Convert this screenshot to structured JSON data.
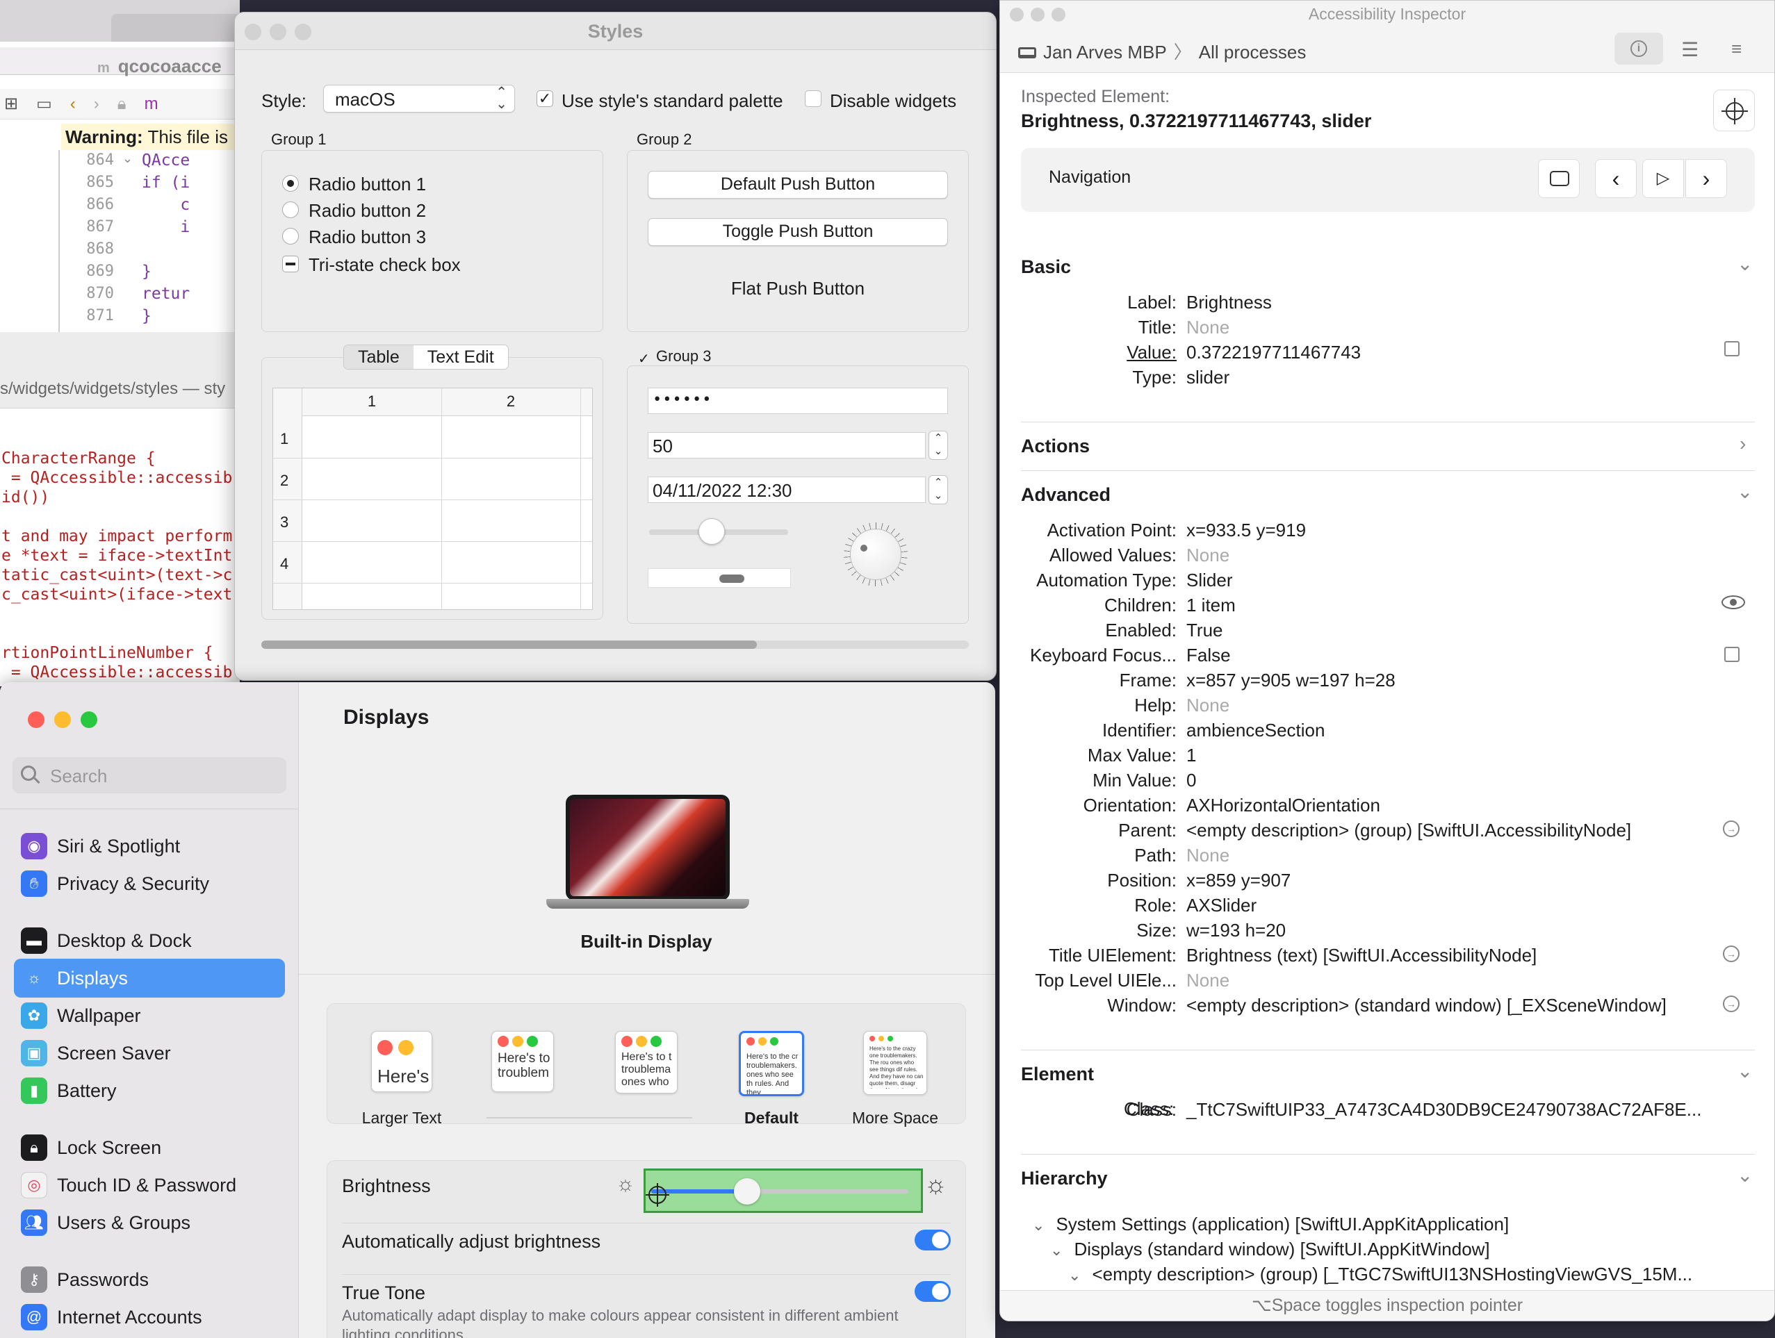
{
  "xcode": {
    "tab": "qcocoaacce",
    "warning_bold": "Warning:",
    "warning_text": " This file is",
    "lines": [
      {
        "n": "864",
        "code": "QAcce"
      },
      {
        "n": "865",
        "code": "if (i"
      },
      {
        "n": "866",
        "code": "    c"
      },
      {
        "n": "867",
        "code": "    i"
      },
      {
        "n": "868",
        "code": ""
      },
      {
        "n": "869",
        "code": "}"
      },
      {
        "n": "870",
        "code": "retur"
      },
      {
        "n": "871",
        "code": "}"
      }
    ]
  },
  "editor2": {
    "path": "s/widgets/widgets/styles — sty",
    "lines": [
      "CharacterRange {",
      " = QAccessible::accessib",
      "id())",
      "",
      "t and may impact perform",
      "e *text = iface->textInt",
      "tatic_cast<uint>(text->c",
      "c_cast<uint>(iface->text",
      "",
      "",
      "rtionPointLineNumber {",
      " = QAccessible::accessib"
    ]
  },
  "styles": {
    "title": "Styles",
    "style_label": "Style:",
    "style_value": "macOS",
    "palette_label": "Use style's standard palette",
    "disable_label": "Disable widgets",
    "group1": {
      "title": "Group 1",
      "radios": [
        "Radio button 1",
        "Radio button 2",
        "Radio button 3"
      ],
      "tristate": "Tri-state check box"
    },
    "group2": {
      "title": "Group 2",
      "default_btn": "Default Push Button",
      "toggle_btn": "Toggle Push Button",
      "flat_btn": "Flat Push Button"
    },
    "tabs": [
      "Table",
      "Text Edit"
    ],
    "table": {
      "cols": [
        "1",
        "2"
      ],
      "rows": [
        "1",
        "2",
        "3",
        "4"
      ]
    },
    "group3": {
      "title": "Group 3",
      "password": "••••••",
      "spin": "50",
      "datetime": "04/11/2022 12:30",
      "slider_value": 0.45,
      "dial_value": 0.35
    },
    "scroll_value": 0.7
  },
  "settings": {
    "search_placeholder": "Search",
    "items": [
      {
        "label": "Siri & Spotlight",
        "icon": "siri-icon",
        "color": "#7a4fd6"
      },
      {
        "label": "Privacy & Security",
        "icon": "hand-icon",
        "color": "#3478f6"
      },
      {
        "label": "Desktop & Dock",
        "icon": "dock-icon",
        "color": "#1c1c1e"
      },
      {
        "label": "Displays",
        "icon": "sun-icon",
        "color": "#3478f6"
      },
      {
        "label": "Wallpaper",
        "icon": "flower-icon",
        "color": "#3aa7e8"
      },
      {
        "label": "Screen Saver",
        "icon": "screensaver-icon",
        "color": "#4fb5e6"
      },
      {
        "label": "Battery",
        "icon": "battery-icon",
        "color": "#34c759"
      },
      {
        "label": "Lock Screen",
        "icon": "lock-icon",
        "color": "#1c1c1e"
      },
      {
        "label": "Touch ID & Password",
        "icon": "fingerprint-icon",
        "color": "#f2f2f2"
      },
      {
        "label": "Users & Groups",
        "icon": "users-icon",
        "color": "#3478f6"
      },
      {
        "label": "Passwords",
        "icon": "key-icon",
        "color": "#8e8e93"
      },
      {
        "label": "Internet Accounts",
        "icon": "at-icon",
        "color": "#3478f6"
      }
    ],
    "selected": "Displays",
    "page_title": "Displays",
    "display_name": "Built-in Display",
    "resolutions": [
      {
        "label": "Larger Text",
        "preview": "Here's",
        "bold": false
      },
      {
        "label": "",
        "preview": "Here's to troublem",
        "bold": false
      },
      {
        "label": "",
        "preview": "Here's to t troublema ones who",
        "bold": false
      },
      {
        "label": "Default",
        "preview": "Here's to the cr troublemakers. ones who see th rules. And they",
        "bold": true
      },
      {
        "label": "More Space",
        "preview": "Here's to the crazy one troublemakers. The rou ones who see things dif rules. And they have no can quote them, disagr them. About the only th Because they change th",
        "bold": false
      }
    ],
    "brightness_label": "Brightness",
    "brightness_value": 0.3722197711467743,
    "auto_label": "Automatically adjust brightness",
    "truetone_label": "True Tone",
    "truetone_desc": "Automatically adapt display to make colours appear consistent in different ambient lighting conditions."
  },
  "inspector": {
    "title": "Accessibility Inspector",
    "host": "Jan Arves MBP",
    "processes": "All processes",
    "inspected_label": "Inspected Element:",
    "inspected_value": "Brightness, 0.3722197711467743, slider",
    "navigation": "Navigation",
    "basic_header": "Basic",
    "basic": [
      {
        "k": "Label:",
        "v": "Brightness",
        "muted": false
      },
      {
        "k": "Title:",
        "v": "None",
        "muted": true
      },
      {
        "k": "Value:",
        "v": "0.3722197711467743",
        "muted": false
      },
      {
        "k": "Type:",
        "v": "slider",
        "muted": false
      }
    ],
    "actions_header": "Actions",
    "advanced_header": "Advanced",
    "advanced": [
      {
        "k": "Activation Point:",
        "v": "x=933.5 y=919",
        "muted": false
      },
      {
        "k": "Allowed Values:",
        "v": "None",
        "muted": true
      },
      {
        "k": "Automation Type:",
        "v": "Slider",
        "muted": false
      },
      {
        "k": "Children:",
        "v": "1 item",
        "muted": false
      },
      {
        "k": "Enabled:",
        "v": "True",
        "muted": false
      },
      {
        "k": "Keyboard Focus...",
        "v": "False",
        "muted": false
      },
      {
        "k": "Frame:",
        "v": "x=857 y=905 w=197 h=28",
        "muted": false
      },
      {
        "k": "Help:",
        "v": "None",
        "muted": true
      },
      {
        "k": "Identifier:",
        "v": "ambienceSection",
        "muted": false
      },
      {
        "k": "Max Value:",
        "v": "1",
        "muted": false
      },
      {
        "k": "Min Value:",
        "v": "0",
        "muted": false
      },
      {
        "k": "Orientation:",
        "v": "AXHorizontalOrientation",
        "muted": false
      },
      {
        "k": "Parent:",
        "v": "<empty description> (group) [SwiftUI.AccessibilityNode]",
        "muted": false
      },
      {
        "k": "Path:",
        "v": "None",
        "muted": true
      },
      {
        "k": "Position:",
        "v": "x=859 y=907",
        "muted": false
      },
      {
        "k": "Role:",
        "v": "AXSlider",
        "muted": false
      },
      {
        "k": "Size:",
        "v": "w=193 h=20",
        "muted": false
      },
      {
        "k": "Title UIElement:",
        "v": "Brightness (text) [SwiftUI.AccessibilityNode]",
        "muted": false
      },
      {
        "k": "Top Level UIEle...",
        "v": "None",
        "muted": true
      },
      {
        "k": "Window:",
        "v": "<empty description> (standard window) [_EXSceneWindow]",
        "muted": false
      }
    ],
    "element_header": "Element",
    "class_key": "Class:",
    "class_value": "_TtC7SwiftUIP33_A7473CA4D30DB9CE24790738AC72AF8E...",
    "hierarchy_header": "Hierarchy",
    "hierarchy": [
      "System Settings (application) [SwiftUI.AppKitApplication]",
      "Displays (standard window) [SwiftUI.AppKitWindow]",
      "<empty description> (group) [_TtGC7SwiftUI13NSHostingViewGVS_15M..."
    ],
    "footer": "⌥Space toggles inspection pointer"
  }
}
